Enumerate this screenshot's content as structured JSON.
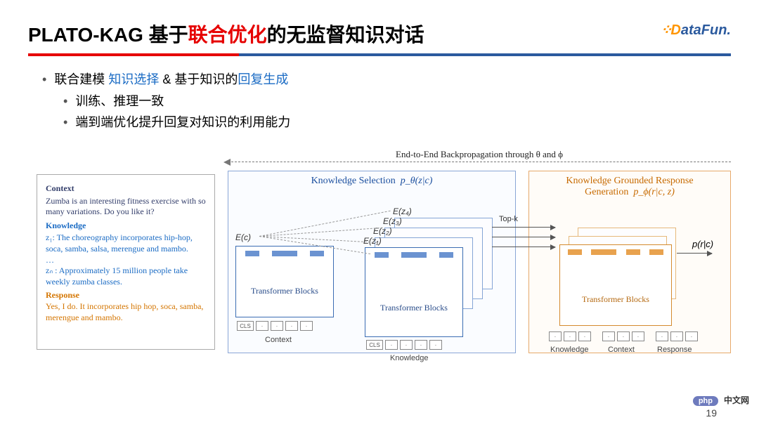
{
  "logo": {
    "d": "D",
    "rest": "ataFun."
  },
  "title": {
    "prefix": "PLATO-KAG 基于",
    "red": "联合优化",
    "suffix": "的无监督知识对话"
  },
  "bullets": {
    "l1_a": "联合建模 ",
    "l1_b": "知识选择",
    "l1_c": " & 基于知识的",
    "l1_d": "回复生成",
    "l2_1": "训练、推理一致",
    "l2_2": "端到端优化提升回复对知识的利用能力"
  },
  "panel": {
    "ctx_h": "Context",
    "ctx": "Zumba is an interesting fitness exercise with so many variations. Do you like it?",
    "kn_h": "Knowledge",
    "kn1_pre": "z₁: ",
    "kn1": "The choreography incorporates hip-hop, soca, samba, salsa, merengue and mambo.",
    "kn_dots": "…",
    "knn_pre": "zₙ : ",
    "knn": "Approximately 15 million people take weekly zumba classes.",
    "resp_h": "Response",
    "resp": "Yes, I do. It incorporates hip hop, soca, samba, merengue and mambo."
  },
  "mid": {
    "title": "Knowledge Selection",
    "math": "p_θ(z|c)"
  },
  "right": {
    "title1": "Knowledge Grounded Response",
    "title2": "Generation",
    "math": "p_ϕ(r|c, z)"
  },
  "top_arrow": "End-to-End Backpropagation through θ and ϕ",
  "blocks": {
    "tb": "Transformer Blocks",
    "ctx": "Context",
    "kn": "Knowledge",
    "resp": "Response",
    "cls": "CLS",
    "dot": "·"
  },
  "labels": {
    "Ec": "E(c)",
    "Ez1": "E(z₁)",
    "Ez2": "E(z₂)",
    "Ez3": "E(z₃)",
    "Ez4": "E(z₄)",
    "topk": "Top-k",
    "out": "p(r|c)"
  },
  "page": "19",
  "php": {
    "badge": "php",
    "text": "中文网"
  }
}
